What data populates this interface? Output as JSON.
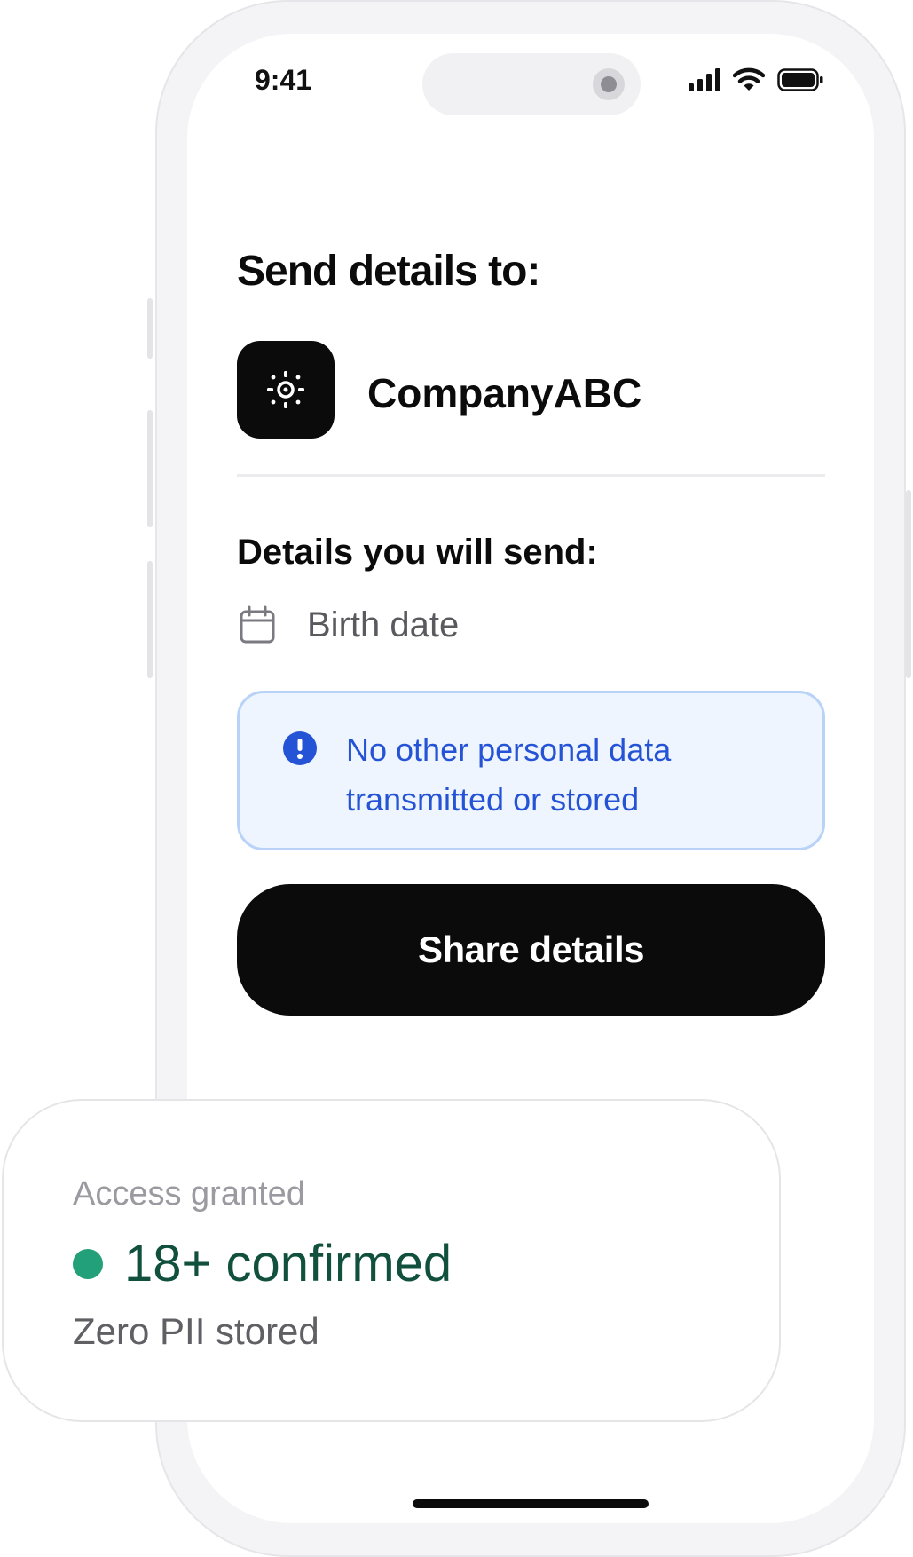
{
  "status_bar": {
    "time": "9:41"
  },
  "share_request": {
    "title": "Send details to:",
    "company_name": "CompanyABC",
    "details_heading": "Details you will send:",
    "details": [
      {
        "icon": "calendar-icon",
        "label": "Birth date"
      }
    ],
    "notice": "No other personal data transmitted or stored",
    "share_button_label": "Share details"
  },
  "confirmation_card": {
    "label": "Access granted",
    "value": "18+ confirmed",
    "sub": "Zero PII stored"
  },
  "colors": {
    "accent_dark": "#0b0b0b",
    "notice_text": "#2553d6",
    "notice_bg": "#eef5fe",
    "success_dot": "#22a079",
    "success_text": "#10503c"
  }
}
